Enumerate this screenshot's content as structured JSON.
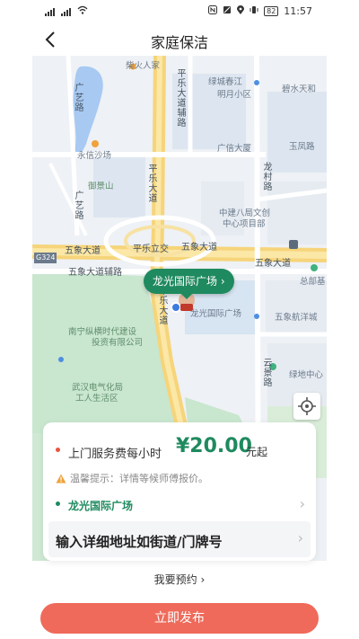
{
  "status": {
    "time": "11:57",
    "battery": "82"
  },
  "header": {
    "title": "家庭保洁"
  },
  "map": {
    "labels": {
      "chaihuo": "柴火人家",
      "lvchengchunjiang": "绿城春江",
      "mingyue": "明月小区",
      "bishuitianhe": "碧水天和",
      "guangxinsha": "广信大厦",
      "yufenglu": "玉凤路",
      "yongxin": "永信沙场",
      "yujingshan": "御景山",
      "zhongjian": "中建八局文创",
      "zhongxin": "中心项目部",
      "wuxiangdadao_left": "五象大道",
      "pingle_lijiao": "平乐立交",
      "wuxiangdadao_mid": "五象大道",
      "wuxiangdadao_right": "五象大道",
      "g324": "G324",
      "fulu": "五象大道辅路",
      "zongbu": "总部基",
      "lvzuguangchang": "龙光国际广场",
      "wuxianghangyang": "五象航洋城",
      "nanning_zongheng": "南宁纵横时代建设",
      "touzi": "投资有限公司",
      "wuhan_dianqi": "武汉电气化局",
      "gongren": "工人生活区",
      "lvdizhongxin": "绿地中心",
      "guangyilu": "广艺路",
      "guangyilu2": "广艺路",
      "pinglefulu": "平乐大道辅路",
      "pingledadao": "平乐大道",
      "pingledadao2": "平乐大道",
      "longcunlu": "龙村路",
      "yunjinglu": "云景路"
    },
    "pin_label": "龙光国际广场",
    "pin_arrow": "›"
  },
  "card": {
    "fee_label": "上门服务费每小时",
    "fee_price": "¥20.00",
    "fee_unit": "元起",
    "tip": "温馨提示：详情等候师傅报价。",
    "address_selected": "龙光国际广场",
    "address_placeholder": "输入详细地址如街道/门牌号"
  },
  "footer": {
    "book_label": "我要预约",
    "book_arrow": "›",
    "publish_label": "立即发布"
  },
  "colors": {
    "accent": "#1f8a5f",
    "publish": "#ef6a5a",
    "dot_red": "#e8553e"
  }
}
